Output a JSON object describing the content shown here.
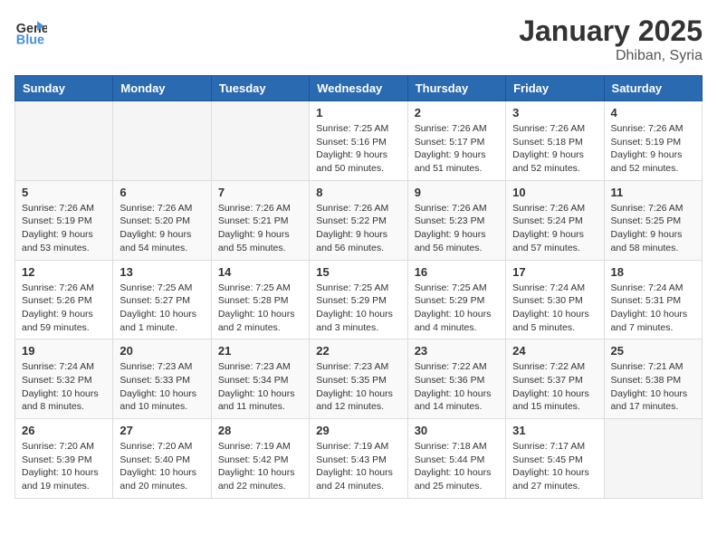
{
  "header": {
    "logo_line1": "General",
    "logo_line2": "Blue",
    "month_title": "January 2025",
    "location": "Dhiban, Syria"
  },
  "days_of_week": [
    "Sunday",
    "Monday",
    "Tuesday",
    "Wednesday",
    "Thursday",
    "Friday",
    "Saturday"
  ],
  "weeks": [
    [
      {
        "day": "",
        "info": ""
      },
      {
        "day": "",
        "info": ""
      },
      {
        "day": "",
        "info": ""
      },
      {
        "day": "1",
        "info": "Sunrise: 7:25 AM\nSunset: 5:16 PM\nDaylight: 9 hours\nand 50 minutes."
      },
      {
        "day": "2",
        "info": "Sunrise: 7:26 AM\nSunset: 5:17 PM\nDaylight: 9 hours\nand 51 minutes."
      },
      {
        "day": "3",
        "info": "Sunrise: 7:26 AM\nSunset: 5:18 PM\nDaylight: 9 hours\nand 52 minutes."
      },
      {
        "day": "4",
        "info": "Sunrise: 7:26 AM\nSunset: 5:19 PM\nDaylight: 9 hours\nand 52 minutes."
      }
    ],
    [
      {
        "day": "5",
        "info": "Sunrise: 7:26 AM\nSunset: 5:19 PM\nDaylight: 9 hours\nand 53 minutes."
      },
      {
        "day": "6",
        "info": "Sunrise: 7:26 AM\nSunset: 5:20 PM\nDaylight: 9 hours\nand 54 minutes."
      },
      {
        "day": "7",
        "info": "Sunrise: 7:26 AM\nSunset: 5:21 PM\nDaylight: 9 hours\nand 55 minutes."
      },
      {
        "day": "8",
        "info": "Sunrise: 7:26 AM\nSunset: 5:22 PM\nDaylight: 9 hours\nand 56 minutes."
      },
      {
        "day": "9",
        "info": "Sunrise: 7:26 AM\nSunset: 5:23 PM\nDaylight: 9 hours\nand 56 minutes."
      },
      {
        "day": "10",
        "info": "Sunrise: 7:26 AM\nSunset: 5:24 PM\nDaylight: 9 hours\nand 57 minutes."
      },
      {
        "day": "11",
        "info": "Sunrise: 7:26 AM\nSunset: 5:25 PM\nDaylight: 9 hours\nand 58 minutes."
      }
    ],
    [
      {
        "day": "12",
        "info": "Sunrise: 7:26 AM\nSunset: 5:26 PM\nDaylight: 9 hours\nand 59 minutes."
      },
      {
        "day": "13",
        "info": "Sunrise: 7:25 AM\nSunset: 5:27 PM\nDaylight: 10 hours\nand 1 minute."
      },
      {
        "day": "14",
        "info": "Sunrise: 7:25 AM\nSunset: 5:28 PM\nDaylight: 10 hours\nand 2 minutes."
      },
      {
        "day": "15",
        "info": "Sunrise: 7:25 AM\nSunset: 5:29 PM\nDaylight: 10 hours\nand 3 minutes."
      },
      {
        "day": "16",
        "info": "Sunrise: 7:25 AM\nSunset: 5:29 PM\nDaylight: 10 hours\nand 4 minutes."
      },
      {
        "day": "17",
        "info": "Sunrise: 7:24 AM\nSunset: 5:30 PM\nDaylight: 10 hours\nand 5 minutes."
      },
      {
        "day": "18",
        "info": "Sunrise: 7:24 AM\nSunset: 5:31 PM\nDaylight: 10 hours\nand 7 minutes."
      }
    ],
    [
      {
        "day": "19",
        "info": "Sunrise: 7:24 AM\nSunset: 5:32 PM\nDaylight: 10 hours\nand 8 minutes."
      },
      {
        "day": "20",
        "info": "Sunrise: 7:23 AM\nSunset: 5:33 PM\nDaylight: 10 hours\nand 10 minutes."
      },
      {
        "day": "21",
        "info": "Sunrise: 7:23 AM\nSunset: 5:34 PM\nDaylight: 10 hours\nand 11 minutes."
      },
      {
        "day": "22",
        "info": "Sunrise: 7:23 AM\nSunset: 5:35 PM\nDaylight: 10 hours\nand 12 minutes."
      },
      {
        "day": "23",
        "info": "Sunrise: 7:22 AM\nSunset: 5:36 PM\nDaylight: 10 hours\nand 14 minutes."
      },
      {
        "day": "24",
        "info": "Sunrise: 7:22 AM\nSunset: 5:37 PM\nDaylight: 10 hours\nand 15 minutes."
      },
      {
        "day": "25",
        "info": "Sunrise: 7:21 AM\nSunset: 5:38 PM\nDaylight: 10 hours\nand 17 minutes."
      }
    ],
    [
      {
        "day": "26",
        "info": "Sunrise: 7:20 AM\nSunset: 5:39 PM\nDaylight: 10 hours\nand 19 minutes."
      },
      {
        "day": "27",
        "info": "Sunrise: 7:20 AM\nSunset: 5:40 PM\nDaylight: 10 hours\nand 20 minutes."
      },
      {
        "day": "28",
        "info": "Sunrise: 7:19 AM\nSunset: 5:42 PM\nDaylight: 10 hours\nand 22 minutes."
      },
      {
        "day": "29",
        "info": "Sunrise: 7:19 AM\nSunset: 5:43 PM\nDaylight: 10 hours\nand 24 minutes."
      },
      {
        "day": "30",
        "info": "Sunrise: 7:18 AM\nSunset: 5:44 PM\nDaylight: 10 hours\nand 25 minutes."
      },
      {
        "day": "31",
        "info": "Sunrise: 7:17 AM\nSunset: 5:45 PM\nDaylight: 10 hours\nand 27 minutes."
      },
      {
        "day": "",
        "info": ""
      }
    ]
  ]
}
